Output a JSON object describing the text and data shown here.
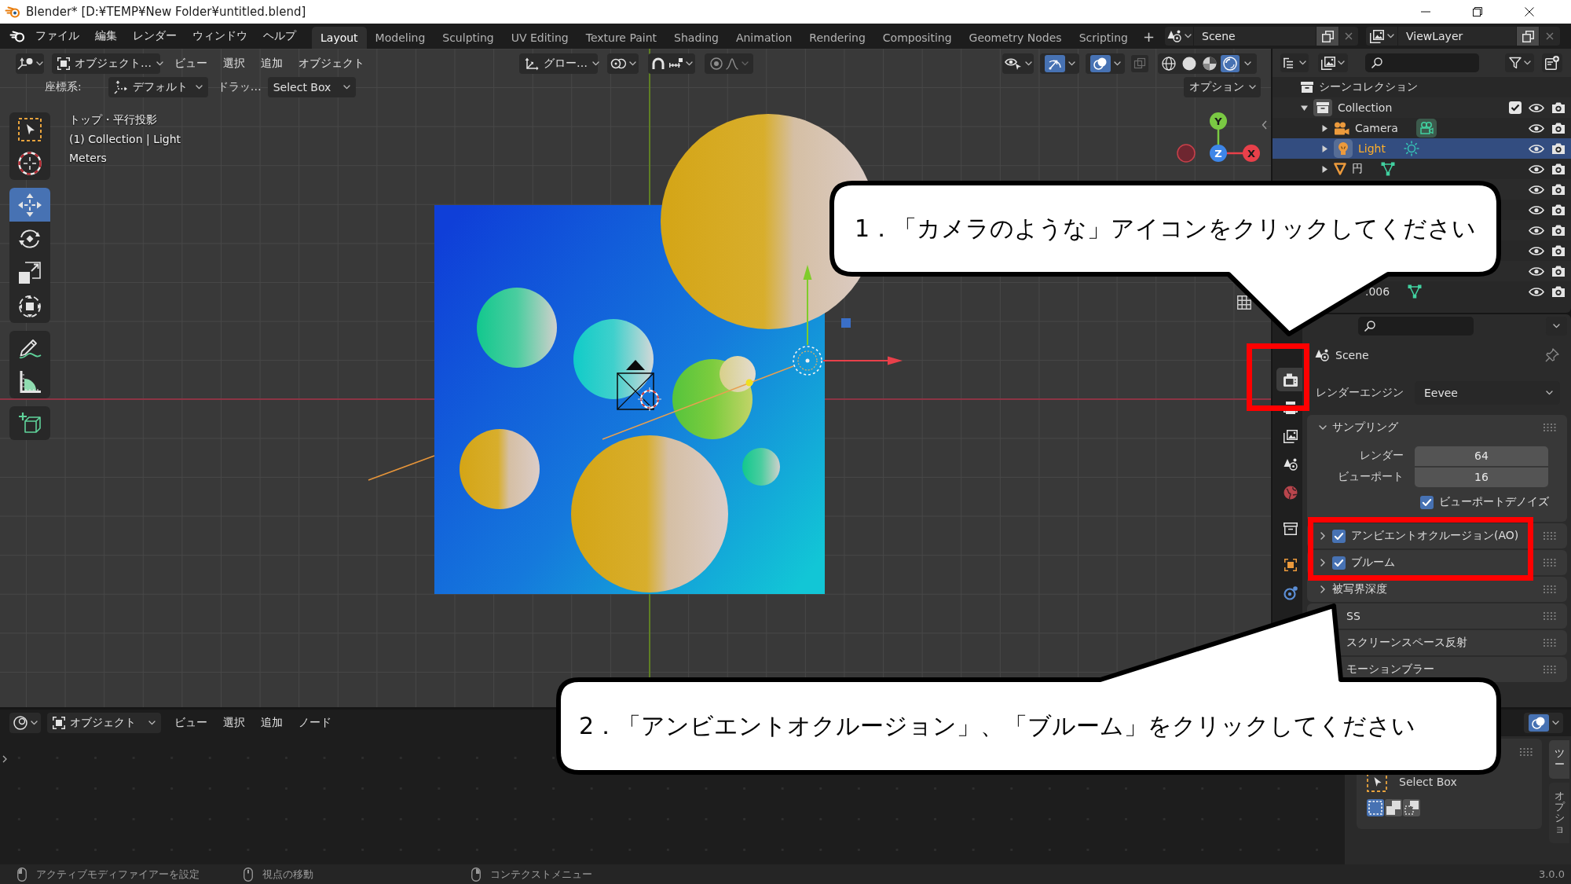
{
  "window": {
    "title": "Blender* [D:¥TEMP¥New Folder¥untitled.blend]"
  },
  "top_bar": {
    "menus": [
      "ファイル",
      "編集",
      "レンダー",
      "ウィンドウ",
      "ヘルプ"
    ],
    "workspaces": [
      {
        "label": "Layout",
        "selected": true
      },
      {
        "label": "Modeling",
        "selected": false
      },
      {
        "label": "Sculpting",
        "selected": false
      },
      {
        "label": "UV Editing",
        "selected": false
      },
      {
        "label": "Texture Paint",
        "selected": false
      },
      {
        "label": "Shading",
        "selected": false
      },
      {
        "label": "Animation",
        "selected": false
      },
      {
        "label": "Rendering",
        "selected": false
      },
      {
        "label": "Compositing",
        "selected": false
      },
      {
        "label": "Geometry Nodes",
        "selected": false
      },
      {
        "label": "Scripting",
        "selected": false
      }
    ],
    "add_workspace": "+",
    "scene": "Scene",
    "view_layer": "ViewLayer"
  },
  "viewport": {
    "header": {
      "mode": "オブジェクト…",
      "menus": [
        "ビュー",
        "選択",
        "追加",
        "オブジェクト"
      ],
      "orientation": "グロー…",
      "gizmos_on": true,
      "overlays_on": true,
      "xray_on": false,
      "shading": [
        {
          "kind": "wireframe",
          "selected": false
        },
        {
          "kind": "solid",
          "selected": false
        },
        {
          "kind": "material",
          "selected": false
        },
        {
          "kind": "rendered",
          "selected": true
        }
      ]
    },
    "tool_settings": {
      "orientation_label": "座標系:",
      "orientation": "デフォルト",
      "drag_label": "ドラッ…",
      "drag": "Select Box",
      "options": "オプション"
    },
    "overlay_text": [
      "トップ・平行投影",
      "(1) Collection | Light",
      "Meters"
    ],
    "tools": [
      {
        "kind": "select_box",
        "selected": false
      },
      {
        "kind": "cursor",
        "selected": false
      },
      {
        "kind": "move",
        "selected": true
      },
      {
        "kind": "rotate",
        "selected": false
      },
      {
        "kind": "scale",
        "selected": false
      },
      {
        "kind": "transform",
        "selected": false
      },
      {
        "kind": "annotate",
        "selected": false
      },
      {
        "kind": "measure",
        "selected": false
      },
      {
        "kind": "add_cube",
        "selected": false
      }
    ],
    "gizmo_axes": [
      {
        "kind": "y",
        "label": "Y"
      },
      {
        "kind": "z",
        "label": "Z"
      },
      {
        "kind": "x",
        "label": "X"
      }
    ]
  },
  "outliner": {
    "root": "シーンコレクション",
    "items": [
      {
        "name": "Collection",
        "kind": "collection",
        "expanded": true,
        "checked": true,
        "selected": false,
        "children": [
          {
            "name": "Camera",
            "kind": "camera",
            "expanded": false,
            "selected": false
          },
          {
            "name": "Light",
            "kind": "light",
            "expanded": false,
            "selected": true
          },
          {
            "name": "円",
            "kind": "mesh",
            "expanded": false,
            "selected": false
          },
          {
            "kind": "covered",
            "selected": false
          },
          {
            "kind": "covered",
            "selected": false
          },
          {
            "kind": "covered",
            "selected": false
          },
          {
            "kind": "covered",
            "selected": false
          },
          {
            "kind": "covered",
            "selected": false
          },
          {
            "name": ".006",
            "kind": "clipped",
            "selected": false
          }
        ]
      }
    ]
  },
  "properties": {
    "tabs": [
      {
        "kind": "render",
        "selected": true
      },
      {
        "kind": "output",
        "selected": false
      },
      {
        "kind": "view_layer",
        "selected": false
      },
      {
        "kind": "scene",
        "selected": false
      },
      {
        "kind": "world",
        "selected": false
      },
      {
        "kind": "collection",
        "selected": false
      },
      {
        "kind": "object",
        "selected": false
      },
      {
        "kind": "physics",
        "selected": false
      }
    ],
    "context": "Scene",
    "engine_label": "レンダーエンジン",
    "engine": "Eevee",
    "panels": [
      {
        "title": "サンプリング",
        "kind": "plain",
        "expanded": true,
        "fields": [
          {
            "label": "レンダー",
            "value": "64"
          },
          {
            "label": "ビューポート",
            "value": "16"
          }
        ],
        "options": [
          {
            "label": "ビューポートデノイズ",
            "checked": true
          }
        ]
      },
      {
        "title": "アンビエントオクルージョン(AO)",
        "kind": "toggle",
        "expanded": false,
        "checked": true
      },
      {
        "title": "ブルーム",
        "kind": "toggle",
        "expanded": false,
        "checked": true
      },
      {
        "title": "被写界深度",
        "kind": "plain",
        "expanded": false
      },
      {
        "title": "SS",
        "kind": "covered"
      },
      {
        "title": "スクリーンスペース反射",
        "kind": "covered"
      },
      {
        "title": "モーションブラー",
        "kind": "covered"
      }
    ]
  },
  "bottom_editor": {
    "mode": "オブジェクト",
    "menus": [
      "ビュー",
      "選択",
      "追加",
      "ノード"
    ],
    "overlays_on": true,
    "sidebar": {
      "tool": "Select Box",
      "modes": [
        {
          "selected": true
        },
        {
          "selected": false
        },
        {
          "selected": false
        }
      ],
      "tabs": [
        {
          "label": "ツー",
          "selected": true
        },
        {
          "label": "オプショ",
          "selected": false
        }
      ]
    }
  },
  "status_bar": {
    "hints": [
      {
        "kind": "left_mouse",
        "text": "アクティブモディファイアーを設定"
      },
      {
        "kind": "middle_mouse",
        "text": "視点の移動"
      },
      {
        "kind": "right_mouse",
        "text": "コンテクストメニュー"
      }
    ],
    "version": "3.0.0"
  },
  "callouts": [
    {
      "text": "1．「カメラのような」アイコンをクリックしてください"
    },
    {
      "text": "2．「アンビエントオクルージョン」、「ブルーム」をクリックしてください"
    }
  ]
}
